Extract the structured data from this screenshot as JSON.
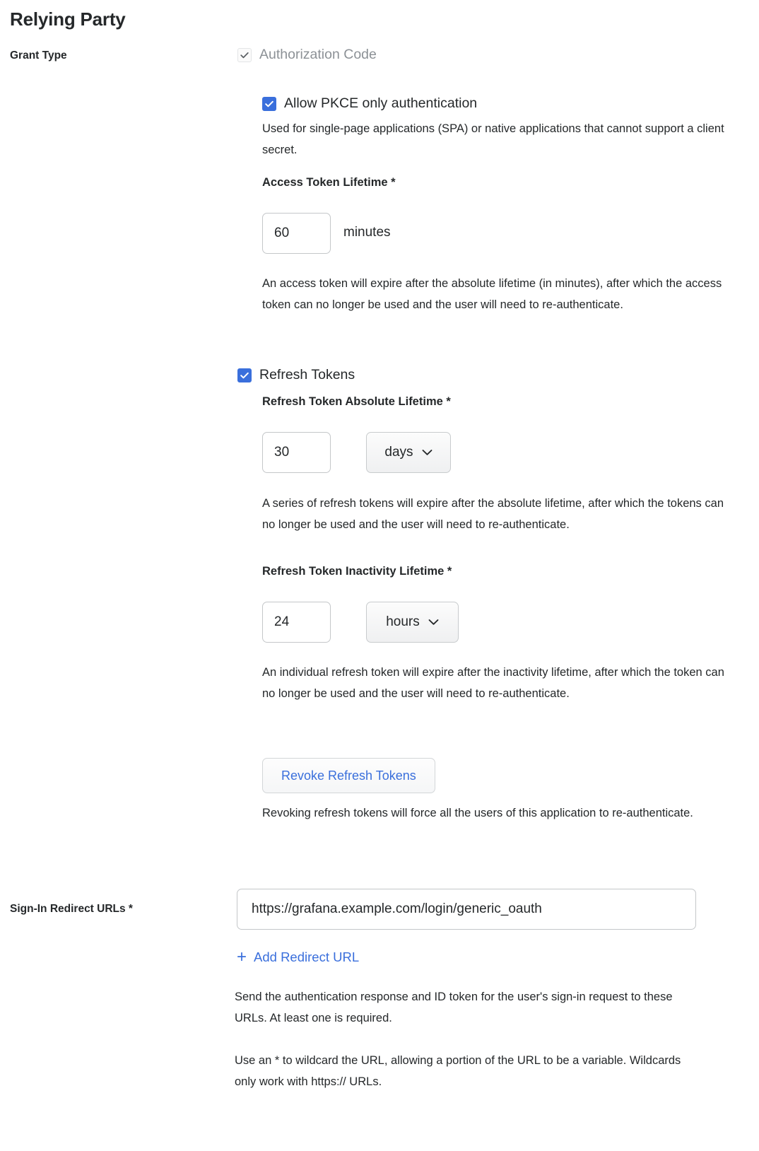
{
  "section": {
    "title": "Relying Party"
  },
  "grant_type": {
    "label": "Grant Type",
    "authorization_code": {
      "label": "Authorization Code",
      "checked": true,
      "disabled": true,
      "icon": "check-icon"
    },
    "pkce": {
      "label": "Allow PKCE only authentication",
      "checked": true,
      "description": "Used for single-page applications (SPA) or native applications that cannot support a client secret.",
      "icon": "check-icon"
    },
    "access_token_lifetime": {
      "label": "Access Token Lifetime *",
      "value": "60",
      "unit": "minutes",
      "description": "An access token will expire after the absolute lifetime (in minutes), after which the access token can no longer be used and the user will need to re-authenticate."
    },
    "refresh_tokens": {
      "label": "Refresh Tokens",
      "checked": true,
      "icon": "check-icon",
      "absolute": {
        "label": "Refresh Token Absolute Lifetime *",
        "value": "30",
        "unit": "days",
        "unit_icon": "chevron-down-icon",
        "description": "A series of refresh tokens will expire after the absolute lifetime, after which the tokens can no longer be used and the user will need to re-authenticate."
      },
      "inactivity": {
        "label": "Refresh Token Inactivity Lifetime *",
        "value": "24",
        "unit": "hours",
        "unit_icon": "chevron-down-icon",
        "description": "An individual refresh token will expire after the inactivity lifetime, after which the token can no longer be used and the user will need to re-authenticate."
      },
      "revoke_button": "Revoke Refresh Tokens",
      "revoke_description": "Revoking refresh tokens will force all the users of this application to re-authenticate."
    }
  },
  "redirect_urls": {
    "label": "Sign-In Redirect URLs *",
    "value": "https://grafana.example.com/login/generic_oauth",
    "add_link": "Add Redirect URL",
    "add_icon": "plus-icon",
    "description_1": "Send the authentication response and ID token for the user's sign-in request to these URLs. At least one is required.",
    "description_2": "Use an * to wildcard the URL, allowing a portion of the URL to be a variable. Wildcards only work with https:// URLs."
  },
  "colors": {
    "accent": "#3a6fdc",
    "text": "#25282a",
    "muted": "#8c9196",
    "border": "#c4c7c9"
  }
}
